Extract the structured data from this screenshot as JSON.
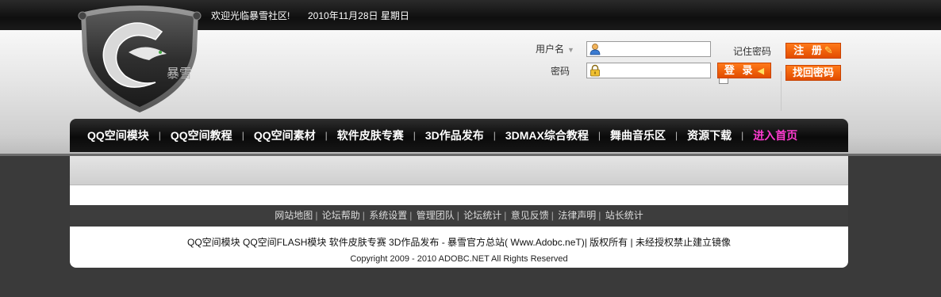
{
  "topbar": {
    "welcome": "欢迎光临暴雪社区!",
    "date": "2010年11月28日  星期日"
  },
  "logo": {
    "text": "暴雪"
  },
  "login": {
    "username_label": "用户名",
    "password_label": "密码",
    "username_value": "",
    "password_value": "",
    "remember_label": "记住密码",
    "login_button": "登 录",
    "register_button": "注 册",
    "forgot_button": "找回密码"
  },
  "nav": {
    "items": [
      {
        "label": "QQ空间模块"
      },
      {
        "label": "QQ空间教程"
      },
      {
        "label": "QQ空间素材"
      },
      {
        "label": "软件皮肤专赛"
      },
      {
        "label": "3D作品发布"
      },
      {
        "label": "3DMAX综合教程"
      },
      {
        "label": "舞曲音乐区"
      },
      {
        "label": "资源下载"
      },
      {
        "label": "进入首页",
        "highlight": true
      }
    ]
  },
  "footer": {
    "nav_items": [
      "网站地图",
      "论坛帮助",
      "系统设置",
      "管理团队",
      "论坛统计",
      "意见反馈",
      "法律声明",
      "站长统计"
    ],
    "links_line": "QQ空间模块  QQ空间FLASH模块  软件皮肤专赛  3D作品发布  - 暴雪官方总站( Www.Adobc.neT)| 版权所有  | 未经授权禁止建立镜像",
    "copyright": "Copyright 2009 - 2010 ADOBC.NET All Rights Reserved"
  },
  "colors": {
    "accent": "#ff5a00",
    "nav_highlight": "#ff3bd0",
    "nav_bg": "#111111"
  }
}
